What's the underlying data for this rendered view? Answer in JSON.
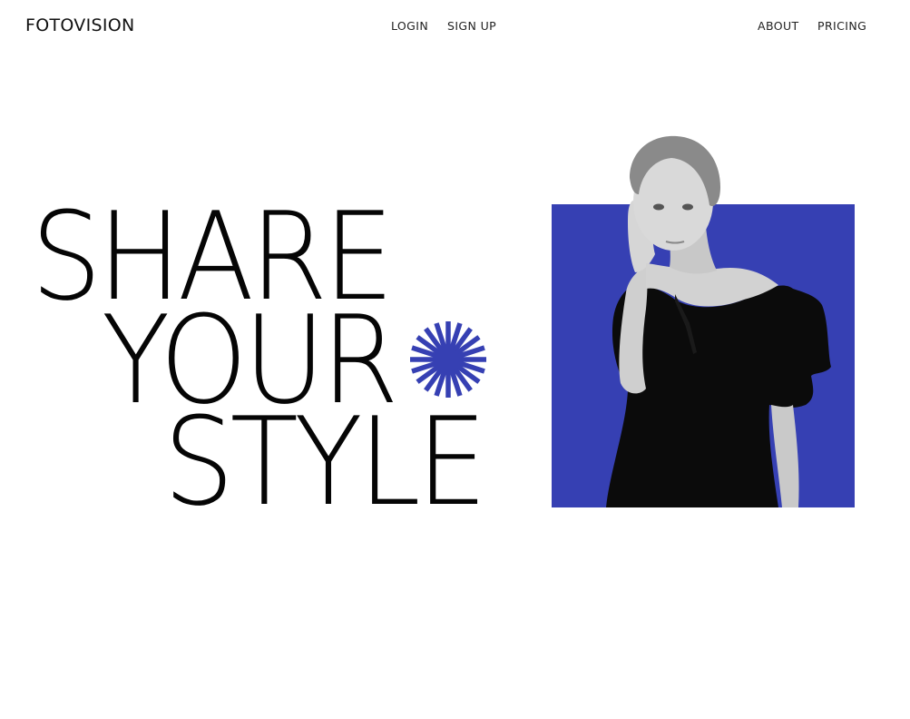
{
  "header": {
    "logo": "FOTOVISION",
    "nav_left": [
      {
        "label": "LOGIN"
      },
      {
        "label": "SIGN UP"
      }
    ],
    "nav_right": [
      {
        "label": "ABOUT"
      },
      {
        "label": "PRICING"
      }
    ]
  },
  "hero": {
    "lines": [
      "SHARE",
      "YOUR",
      "STYLE"
    ]
  },
  "colors": {
    "accent_blue": "#3640b3",
    "text": "#050505",
    "background": "#ffffff"
  },
  "icons": {
    "burst": "sun-burst-icon"
  }
}
